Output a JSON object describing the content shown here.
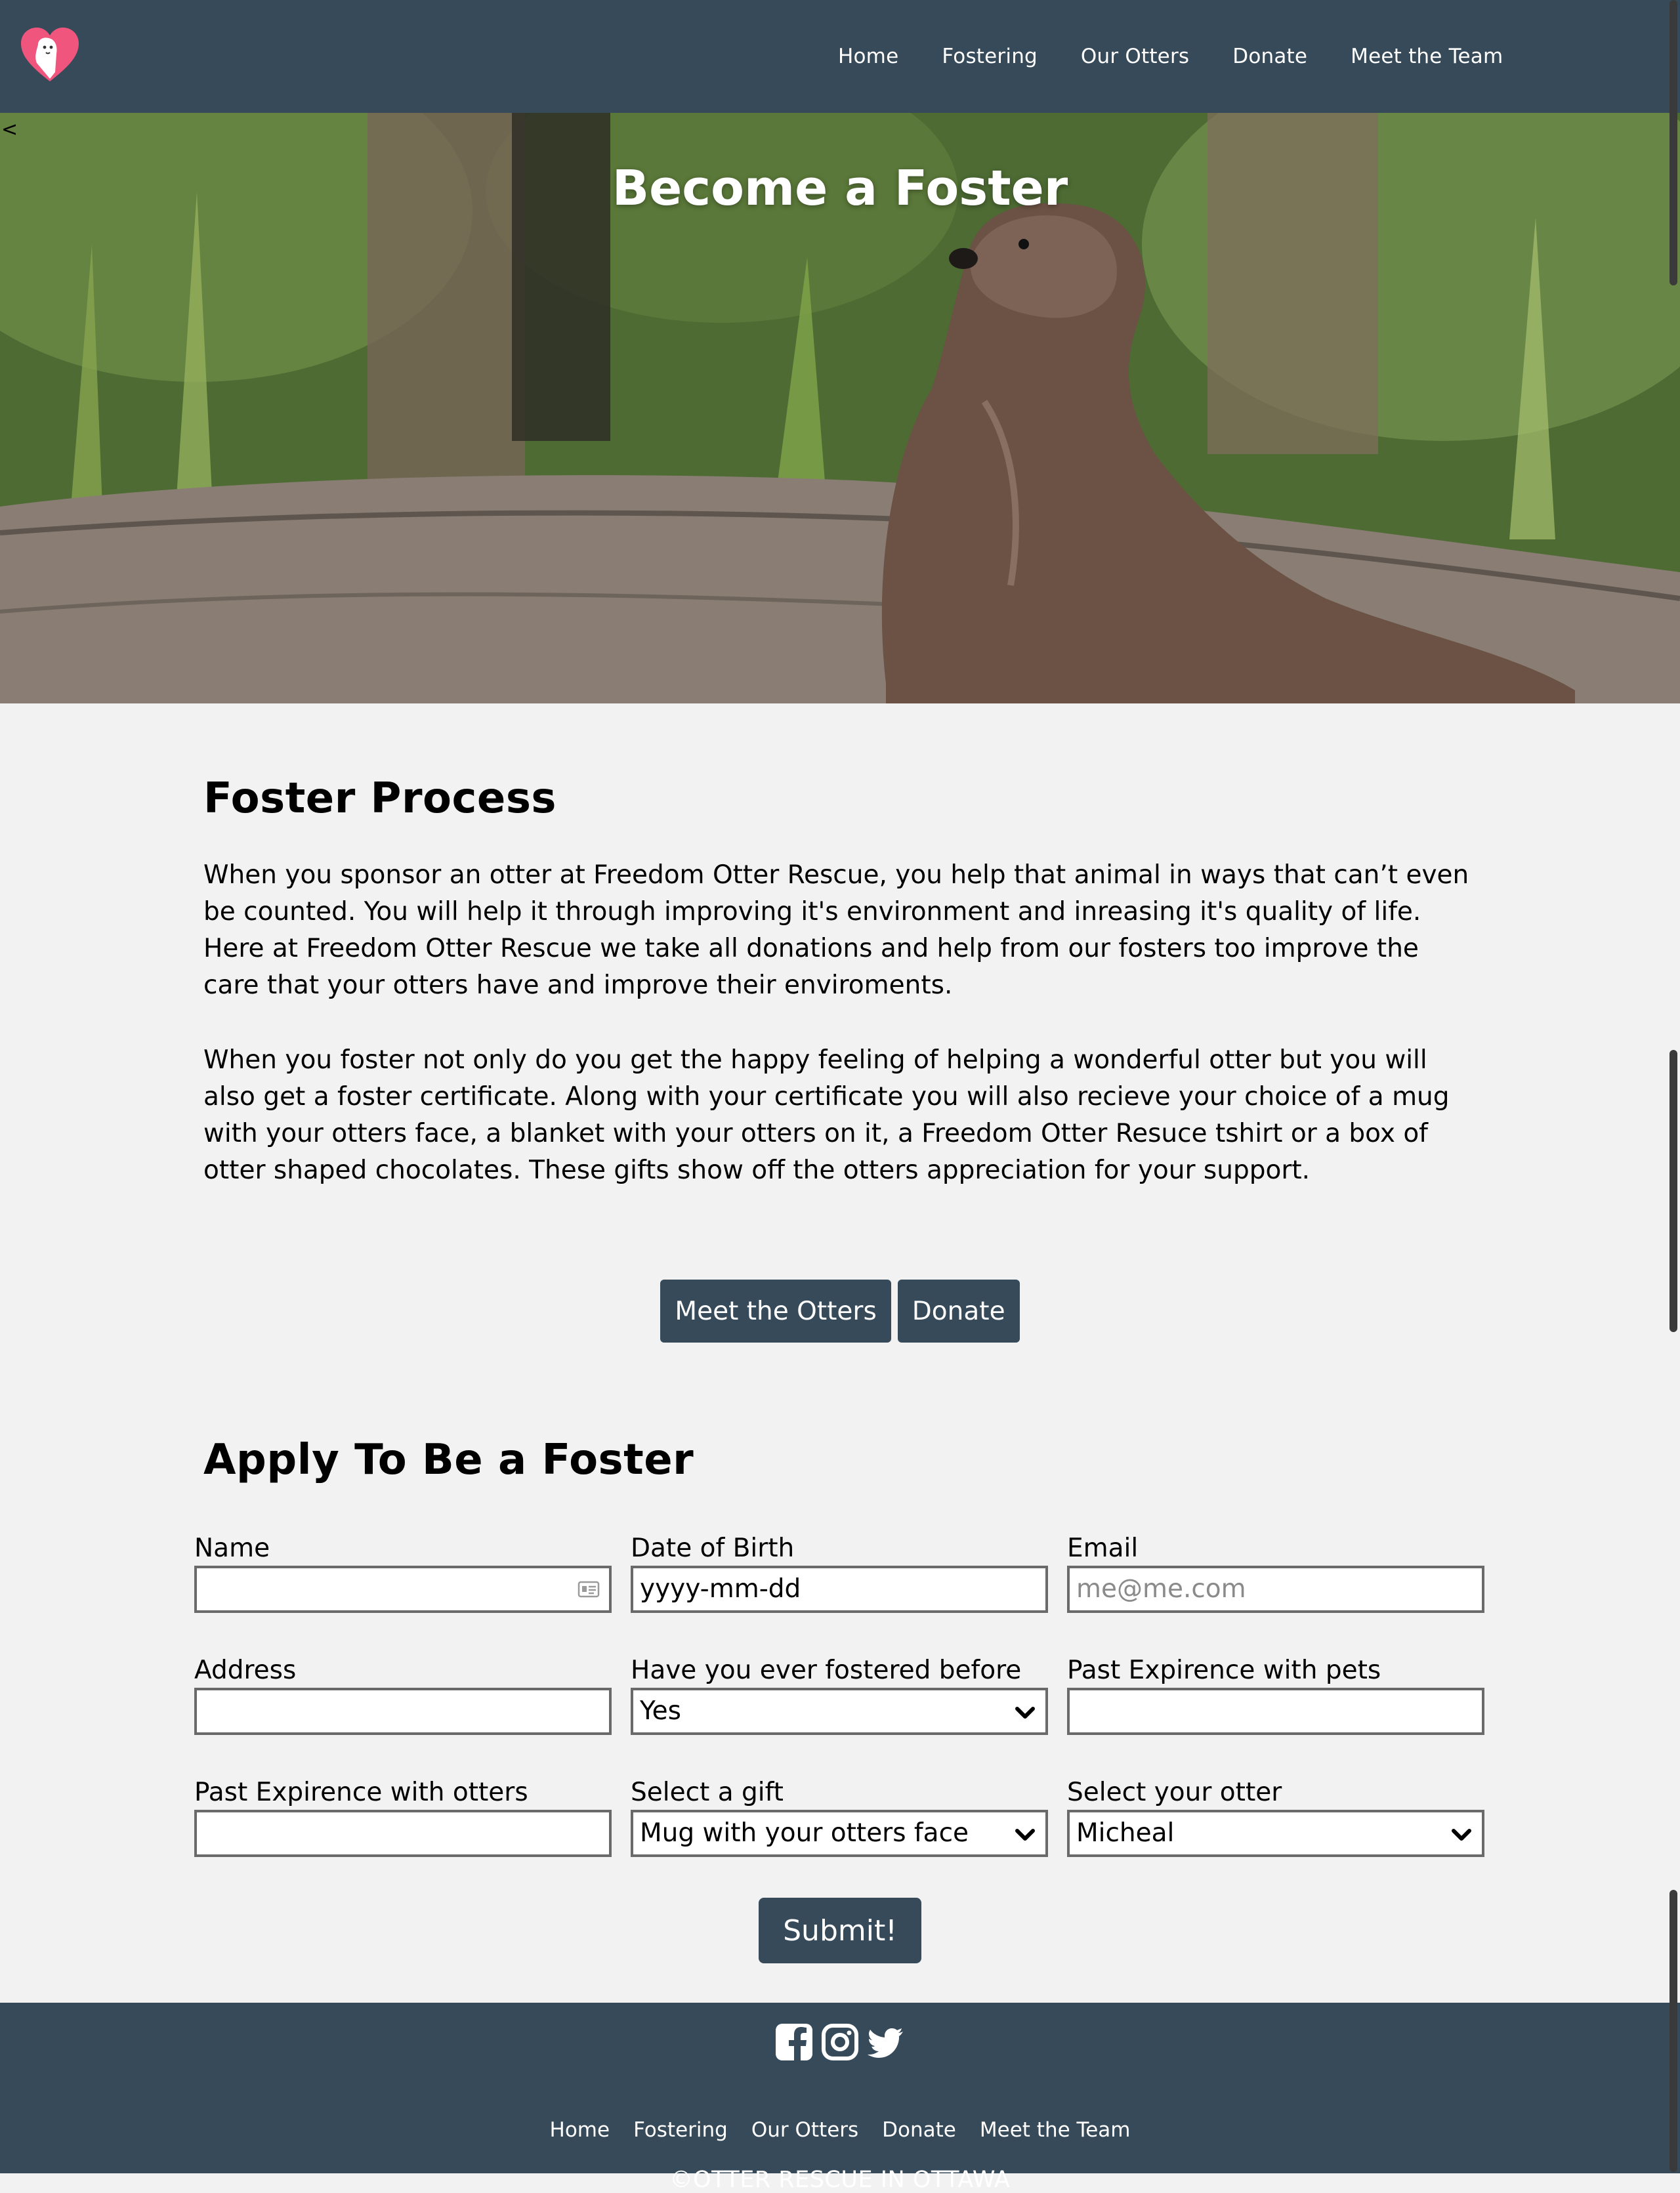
{
  "header": {
    "logo_icon": "otter-heart-logo-icon",
    "nav": [
      {
        "label": "Home"
      },
      {
        "label": "Fostering"
      },
      {
        "label": "Our Otters"
      },
      {
        "label": "Donate"
      },
      {
        "label": "Meet the Team"
      }
    ]
  },
  "hero": {
    "title": "Become a Foster",
    "back_glyph": "<"
  },
  "process": {
    "heading": "Foster Process",
    "paragraph1": "When you sponsor an otter at Freedom Otter Rescue, you help that animal in ways that can’t even be counted. You will help it through improving it's environment and inreasing it's quality of life. Here at Freedom Otter Rescue we take all donations and help from our fosters too improve the care that your otters have and improve their enviroments.",
    "paragraph2": "When you foster not only do you get the happy feeling of helping a wonderful otter but you will also get a foster certificate. Along with your certificate you will also recieve your choice of a mug with your otters face, a blanket with your otters on it, a Freedom Otter Resuce tshirt or a box of otter shaped chocolates. These gifts show off the otters appreciation for your support.",
    "buttons": {
      "meet": "Meet the Otters",
      "donate": "Donate"
    }
  },
  "apply": {
    "heading": "Apply To Be a Foster",
    "fields": {
      "name": {
        "label": "Name",
        "value": ""
      },
      "dob": {
        "label": "Date of Birth",
        "value": "yyyy-mm-dd"
      },
      "email": {
        "label": "Email",
        "placeholder": "me@me.com"
      },
      "address": {
        "label": "Address",
        "value": ""
      },
      "fostered": {
        "label": "Have you ever fostered before",
        "selected": "Yes"
      },
      "pets": {
        "label": "Past Expirence with pets",
        "value": ""
      },
      "otters": {
        "label": "Past Expirence with otters",
        "value": ""
      },
      "gift": {
        "label": "Select a gift",
        "selected": "Mug with your otters face"
      },
      "otter": {
        "label": "Select your otter",
        "selected": "Micheal"
      }
    },
    "submit": "Submit!"
  },
  "footer": {
    "social_icons": [
      "facebook-icon",
      "instagram-icon",
      "twitter-icon"
    ],
    "nav": [
      {
        "label": "Home"
      },
      {
        "label": "Fostering"
      },
      {
        "label": "Our Otters"
      },
      {
        "label": "Donate"
      },
      {
        "label": "Meet the Team"
      }
    ],
    "copyright": "©OTTER RESCUE IN OTTAWA"
  },
  "colors": {
    "header_bg": "#364a59",
    "page_bg": "#f2f2f2",
    "logo_pink": "#f0557d"
  }
}
